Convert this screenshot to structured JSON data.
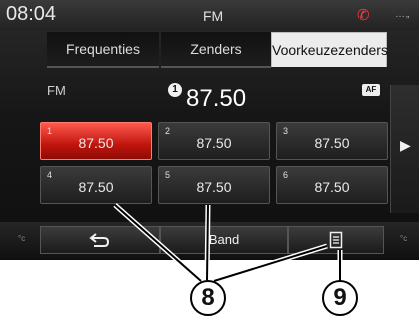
{
  "status": {
    "time": "08:04",
    "source": "FM",
    "phone_icon": "phone-icon",
    "signal_icon": "signal-icon"
  },
  "tabs": [
    {
      "label": "Frequenties"
    },
    {
      "label": "Zenders"
    },
    {
      "label": "Voorkeuzezenders",
      "active": true
    }
  ],
  "header": {
    "band": "FM",
    "preset_number": "1",
    "frequency": "87.50",
    "af_badge": "AF"
  },
  "presets": [
    {
      "num": "1",
      "freq": "87.50",
      "selected": true
    },
    {
      "num": "2",
      "freq": "87.50"
    },
    {
      "num": "3",
      "freq": "87.50"
    },
    {
      "num": "4",
      "freq": "87.50"
    },
    {
      "num": "5",
      "freq": "87.50"
    },
    {
      "num": "6",
      "freq": "87.50"
    }
  ],
  "bottom": {
    "back_icon": "back-arrow-icon",
    "band_label": "Band",
    "list_icon": "list-icon",
    "temp_left": "°c",
    "temp_right": "°c"
  },
  "callouts": [
    "8",
    "9"
  ],
  "colors": {
    "selected_red": "#d8231a",
    "background": "#161616"
  }
}
